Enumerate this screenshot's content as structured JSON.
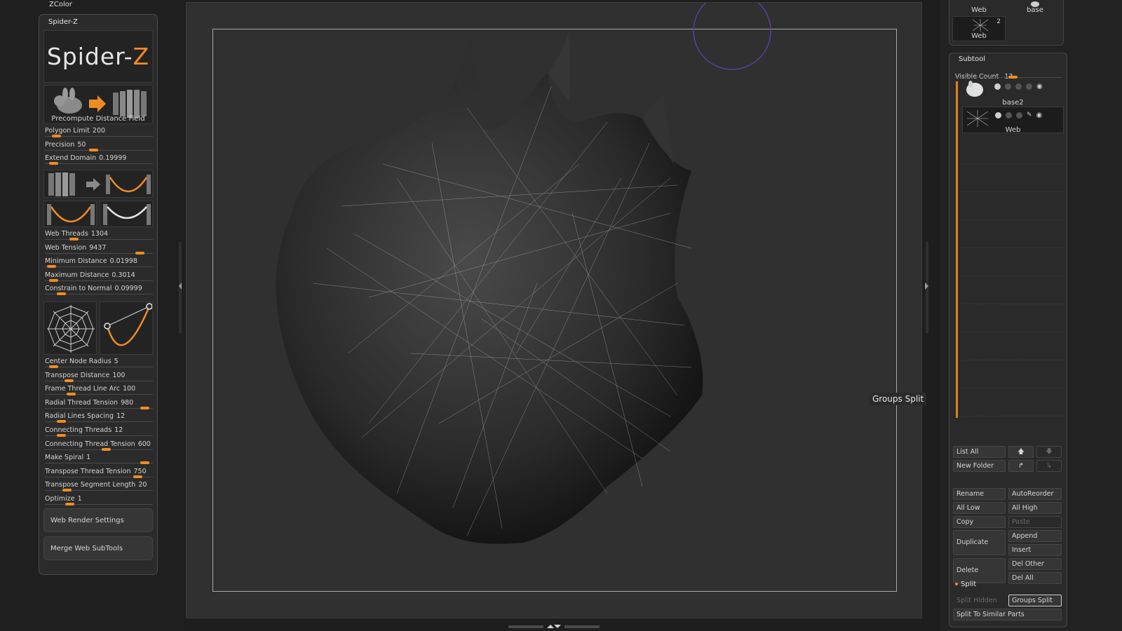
{
  "header": {
    "zcolor_label": "ZColor"
  },
  "plugin": {
    "title": "Spider-Z",
    "logo": {
      "main": "Spider-",
      "accent": "Z"
    },
    "precompute_caption": "Precompute Distance Field",
    "sliders_top": [
      {
        "label": "Polygon Limit",
        "value": "200",
        "pct": 0.07
      },
      {
        "label": "Precision",
        "value": "50",
        "pct": 0.45
      },
      {
        "label": "Extend Domain",
        "value": "0.19999",
        "pct": 0.04
      }
    ],
    "sliders_mid": [
      {
        "label": "Web Threads",
        "value": "1304",
        "pct": 0.25
      },
      {
        "label": "Web Tension",
        "value": "9437",
        "pct": 0.92
      },
      {
        "label": "Minimum Distance",
        "value": "0.01998",
        "pct": 0.02
      },
      {
        "label": "Maximum Distance",
        "value": "0.3014",
        "pct": 0.04
      },
      {
        "label": "Constrain to Normal",
        "value": "0.09999",
        "pct": 0.12
      }
    ],
    "sliders_bottom": [
      {
        "label": "Center Node Radius",
        "value": "5",
        "pct": 0.04
      },
      {
        "label": "Transpose Distance",
        "value": "100",
        "pct": 0.2
      },
      {
        "label": "Frame Thread Line Arc",
        "value": "100",
        "pct": 0.22
      },
      {
        "label": "Radial Thread Tension",
        "value": "980",
        "pct": 0.97
      },
      {
        "label": "Radial Lines Spacing",
        "value": "12",
        "pct": 0.12
      },
      {
        "label": "Connecting Threads",
        "value": "12",
        "pct": 0.12
      },
      {
        "label": "Connecting Thread Tension",
        "value": "600",
        "pct": 0.58
      },
      {
        "label": "Make Spiral",
        "value": "1",
        "pct": 0.97
      },
      {
        "label": "Transpose Thread Tension",
        "value": "750",
        "pct": 0.9
      },
      {
        "label": "Transpose Segment Length",
        "value": "20",
        "pct": 0.18
      },
      {
        "label": "Optimize",
        "value": "1",
        "pct": 0.21
      }
    ],
    "web_render_settings": "Web Render Settings",
    "merge_web_subtools": "Merge Web SubTools"
  },
  "viewport": {
    "tooltip": "Groups Split"
  },
  "thumbs": [
    {
      "caption": "Web"
    },
    {
      "caption": "base"
    },
    {
      "caption": "Web",
      "badge": "2"
    }
  ],
  "subtool": {
    "title": "Subtool",
    "visible_count_label": "Visible Count",
    "visible_count_value": "13",
    "visible_count_pct": 0.5,
    "items": [
      {
        "name": "base2"
      },
      {
        "name": "Web"
      }
    ],
    "buttons": {
      "list_all": "List All",
      "new_folder": "New Folder",
      "rename": "Rename",
      "auto_reorder": "AutoReorder",
      "all_low": "All Low",
      "all_high": "All High",
      "copy": "Copy",
      "paste": "Paste",
      "duplicate": "Duplicate",
      "append": "Append",
      "insert": "Insert",
      "delete": "Delete",
      "del_other": "Del Other",
      "del_all": "Del All",
      "split": "Split",
      "split_hidden": "Split Hidden",
      "groups_split": "Groups Split",
      "split_to_similar": "Split To Similar Parts"
    }
  },
  "colors": {
    "accent": "#f08c22",
    "panel": "#2b2b2b",
    "viewport": "#303030",
    "frame": "#a8a8a8"
  }
}
